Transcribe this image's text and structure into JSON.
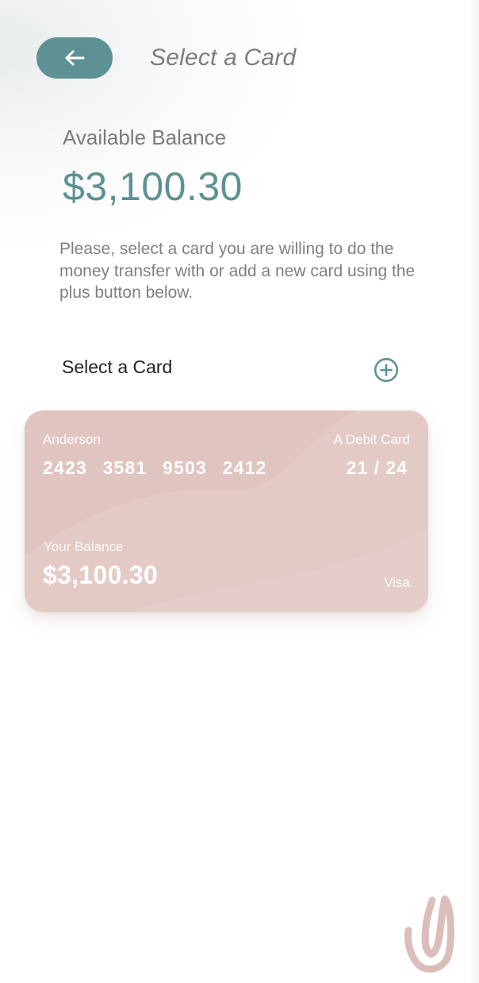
{
  "header": {
    "title": "Select a Card",
    "back_icon": "arrow-left-icon"
  },
  "balance": {
    "label": "Available Balance",
    "amount": "$3,100.30"
  },
  "instructions": "Please, select a card you are willing to do the money transfer with or add a new card using the plus button below.",
  "cards_section": {
    "title": "Select a Card",
    "add_icon": "plus-circle-icon"
  },
  "card": {
    "holder": "Anderson",
    "type": "A Debit Card",
    "number": "2423 3581 9503 2412",
    "expiry": "21 / 24",
    "balance_label": "Your Balance",
    "balance": "$3,100.30",
    "network": "Visa"
  },
  "colors": {
    "accent": "#5e9194",
    "card": "#e0c4bf",
    "text_muted": "#7f7f7f"
  },
  "logo_icon": "brush-stroke-logo-icon"
}
